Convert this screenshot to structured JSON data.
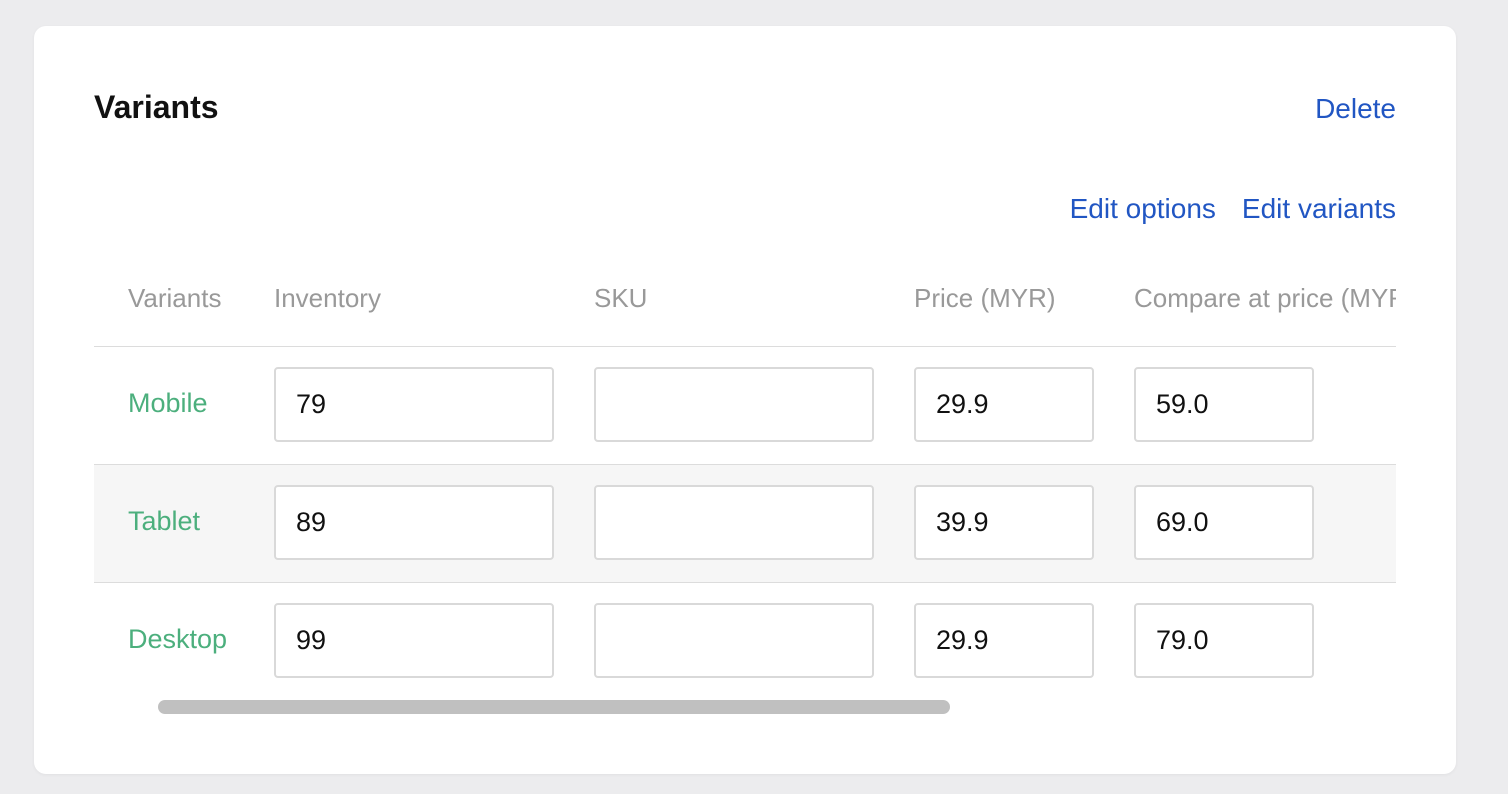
{
  "card": {
    "title": "Variants",
    "delete_label": "Delete",
    "edit_options_label": "Edit options",
    "edit_variants_label": "Edit variants"
  },
  "table": {
    "columns": [
      "Variants",
      "Inventory",
      "SKU",
      "Price (MYR)",
      "Compare at price (MYR)"
    ],
    "rows": [
      {
        "variant": "Mobile",
        "inventory": "79",
        "sku": "",
        "price": "29.9",
        "compare_at_price": "59.0"
      },
      {
        "variant": "Tablet",
        "inventory": "89",
        "sku": "",
        "price": "39.9",
        "compare_at_price": "69.0"
      },
      {
        "variant": "Desktop",
        "inventory": "99",
        "sku": "",
        "price": "29.9",
        "compare_at_price": "79.0"
      }
    ]
  },
  "colors": {
    "link": "#2156c3",
    "variant_name": "#4caf7d",
    "header_text": "#999999",
    "alt_row_bg": "#f6f6f6"
  }
}
